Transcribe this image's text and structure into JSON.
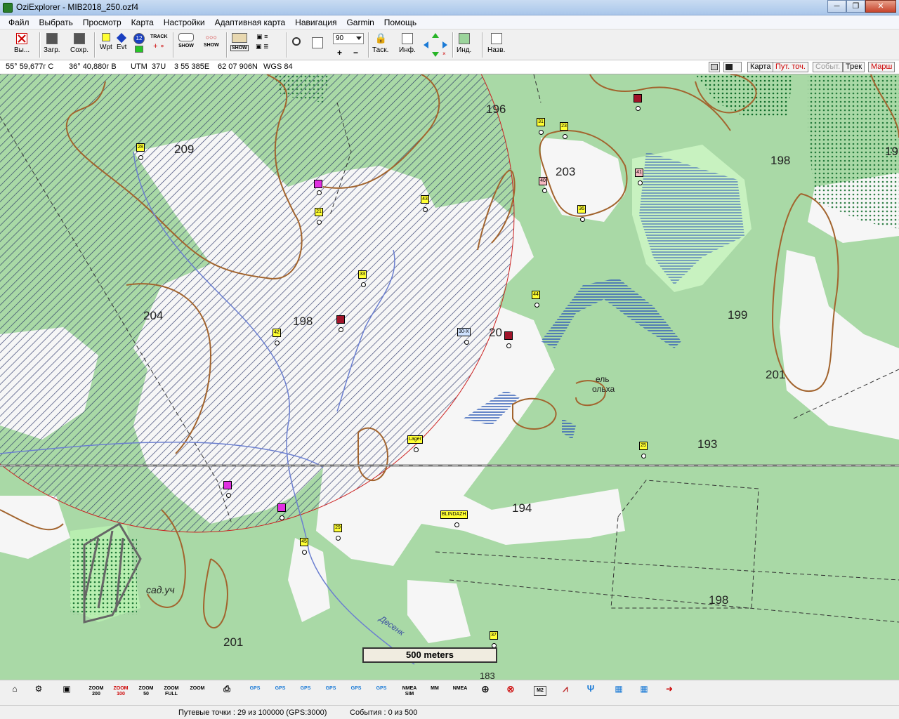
{
  "titlebar": {
    "title": "OziExplorer - MIB2018_250.ozf4"
  },
  "menu": [
    "Файл",
    "Выбрать",
    "Просмотр",
    "Карта",
    "Настройки",
    "Адаптивная карта",
    "Навигация",
    "Garmin",
    "Помощь"
  ],
  "toolbar": {
    "exit": "Вы...",
    "load": "Загр.",
    "save": "Сохр.",
    "wpt": "Wpt",
    "evt": "Evt",
    "track": "TRACK",
    "show": "SHOW",
    "line": "LINE",
    "zoom_value": "90",
    "task": "Таск.",
    "info": "Инф.",
    "ind": "Инд.",
    "names": "Назв."
  },
  "coords": {
    "lat": "55° 59,677г С",
    "lon": "36° 40,880г В",
    "utm": "UTM",
    "zone": "37U",
    "easting": "3 55 385E",
    "northing": "62 07 906N",
    "datum": "WGS 84"
  },
  "modes": {
    "map": "Карта",
    "wpt": "Пут. точ.",
    "events": "Событ.",
    "track": "Трек",
    "route": "Марш"
  },
  "map": {
    "scale": "500 meters",
    "elevations": [
      "196",
      "209",
      "203",
      "198",
      "19",
      "204",
      "198",
      "199",
      "20",
      "201",
      "193",
      "194",
      "198",
      "201",
      "183"
    ],
    "labels": {
      "spruce": "ель",
      "alder": "ольха",
      "garden": "сад.уч",
      "river": "Десенк"
    },
    "waypoints": [
      "28",
      "21",
      "43",
      "31",
      "23",
      "40",
      "41",
      "36",
      "33",
      "42",
      "44",
      "30-X",
      "Lager",
      "25",
      "BLINDAZH",
      "29",
      "45",
      "37"
    ]
  },
  "bottom": {
    "zoom200": "ZOOM 200",
    "zoom100": "ZOOM 100",
    "zoom50": "ZOOM 50",
    "zoomfull": "ZOOM FULL",
    "zoom": "ZOOM",
    "gps": "GPS",
    "nmea_sim": "NMEA SIM",
    "mm": "MM",
    "nmea": "NMEA",
    "m2": "M2"
  },
  "status": {
    "waypoints": "Путевые точки : 29 из 100000  (GPS:3000)",
    "events": "События : 0 из 500"
  }
}
